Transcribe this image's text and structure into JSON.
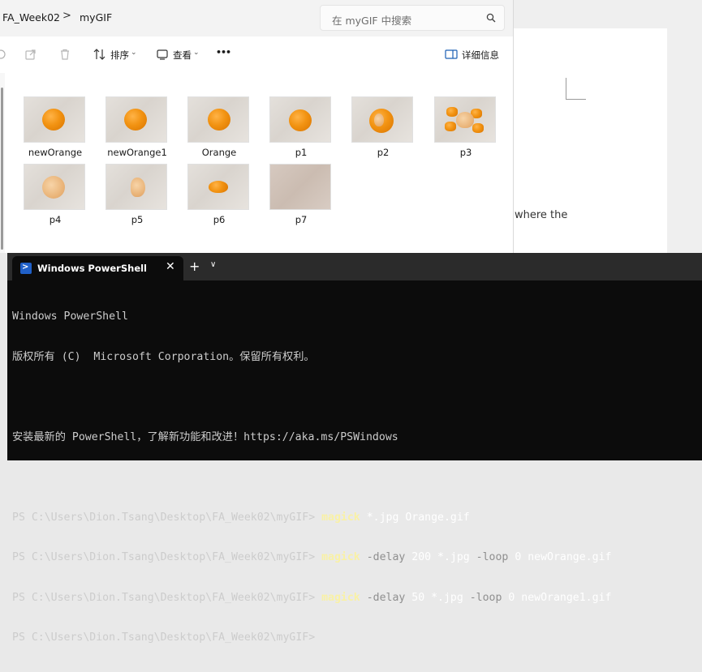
{
  "document_bg": {
    "visible_text": "where the"
  },
  "explorer": {
    "breadcrumb": [
      "FA_Week02",
      "myGIF"
    ],
    "breadcrumb_sep": ">",
    "search_placeholder": "在 myGIF 中搜索",
    "toolbar": {
      "sort_label": "排序",
      "view_label": "查看",
      "more_label": "•••",
      "details_label": "详细信息"
    },
    "files": [
      {
        "name": "newOrange",
        "thumb": "orange-whole"
      },
      {
        "name": "newOrange1",
        "thumb": "orange-whole"
      },
      {
        "name": "Orange",
        "thumb": "orange-whole"
      },
      {
        "name": "p1",
        "thumb": "orange-whole"
      },
      {
        "name": "p2",
        "thumb": "orange-peeling"
      },
      {
        "name": "p3",
        "thumb": "orange-peeled"
      },
      {
        "name": "p4",
        "thumb": "orange-peeled-whole"
      },
      {
        "name": "p5",
        "thumb": "orange-segment"
      },
      {
        "name": "p6",
        "thumb": "orange-slice"
      },
      {
        "name": "p7",
        "thumb": "empty"
      }
    ]
  },
  "terminal": {
    "tab_title": "Windows PowerShell",
    "tab_close": "✕",
    "new_tab": "+",
    "dropdown": "⌄",
    "banner": [
      "Windows PowerShell",
      "版权所有 (C)  Microsoft Corporation。保留所有权利。",
      "",
      "安装最新的 PowerShell，了解新功能和改进！https://aka.ms/PSWindows",
      ""
    ],
    "prompt": "PS C:\\Users\\Dion.Tsang\\Desktop\\FA_Week02\\myGIF> ",
    "commands": [
      [
        {
          "t": "magick",
          "c": "cmd"
        },
        {
          "t": " *.jpg Orange.gif",
          "c": "lit"
        }
      ],
      [
        {
          "t": "magick",
          "c": "cmd"
        },
        {
          "t": " -delay",
          "c": "param"
        },
        {
          "t": " 200 *.jpg ",
          "c": "lit"
        },
        {
          "t": "-loop",
          "c": "param"
        },
        {
          "t": " 0 newOrange.gif",
          "c": "lit"
        }
      ],
      [
        {
          "t": "magick",
          "c": "cmd"
        },
        {
          "t": " -delay",
          "c": "param"
        },
        {
          "t": " 50 *.jpg ",
          "c": "lit"
        },
        {
          "t": "-loop",
          "c": "param"
        },
        {
          "t": " 0 newOrange1.gif",
          "c": "lit"
        }
      ],
      []
    ]
  },
  "colors": {
    "terminal_bg": "#0c0c0c",
    "command": "#f9f1a5",
    "parameter": "#8f8f8f",
    "accent_blue": "#2060c8"
  }
}
